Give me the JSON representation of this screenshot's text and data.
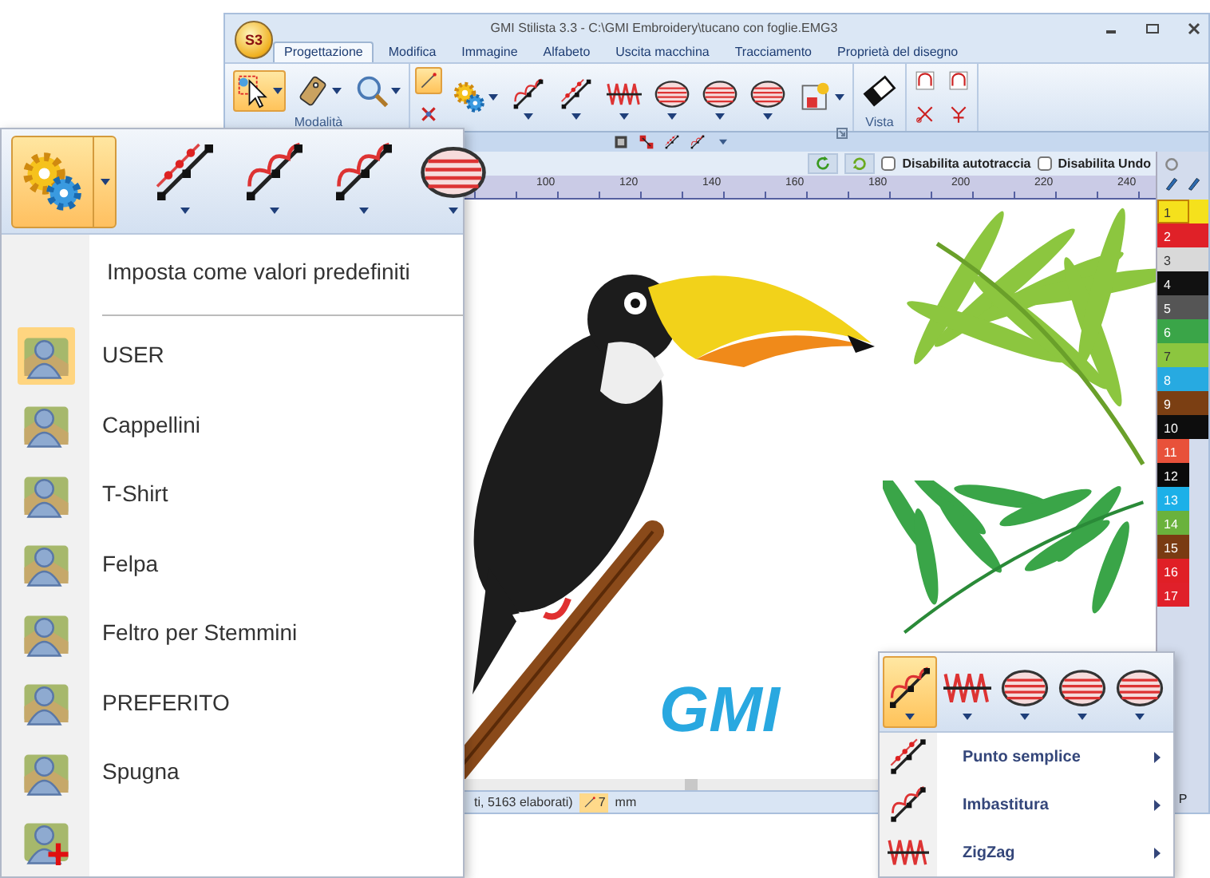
{
  "window": {
    "title": "GMI Stilista 3.3 - C:\\GMI Embroidery\\tucano con foglie.EMG3",
    "logo": "S3"
  },
  "tabs": [
    {
      "label": "Progettazione",
      "selected": true
    },
    {
      "label": "Modifica",
      "selected": false
    },
    {
      "label": "Immagine",
      "selected": false
    },
    {
      "label": "Alfabeto",
      "selected": false
    },
    {
      "label": "Uscita macchina",
      "selected": false
    },
    {
      "label": "Tracciamento",
      "selected": false
    },
    {
      "label": "Proprietà del disegno",
      "selected": false
    }
  ],
  "ribbon": {
    "groups": [
      {
        "label": "Modalità",
        "tools": [
          {
            "kind": "select",
            "selected": true,
            "dropdown": true
          },
          {
            "kind": "tag",
            "selected": false,
            "dropdown": true
          },
          {
            "kind": "zoom",
            "selected": false,
            "dropdown": true
          }
        ]
      },
      {
        "launcher": true,
        "tools": [
          {
            "kind": "stack",
            "items": [
              {
                "kind": "needle",
                "selected": true
              },
              {
                "kind": "cross",
                "selected": false
              }
            ]
          },
          {
            "kind": "gears",
            "selected": false,
            "dropdown": true
          },
          {
            "kind": "baste",
            "selected": false,
            "dropdown": true,
            "caret_below": true
          },
          {
            "kind": "running",
            "selected": false,
            "dropdown": true,
            "caret_below": true
          },
          {
            "kind": "zigzag",
            "selected": false,
            "dropdown": true,
            "caret_below": true
          },
          {
            "kind": "fill",
            "selected": false,
            "dropdown": true,
            "caret_below": true
          },
          {
            "kind": "fill",
            "selected": false,
            "dropdown": true,
            "caret_below": true
          },
          {
            "kind": "fill",
            "selected": false,
            "dropdown": true,
            "caret_below": true
          },
          {
            "kind": "picture",
            "selected": false,
            "dropdown": true
          }
        ]
      },
      {
        "label": "Vista",
        "tools": [
          {
            "kind": "eraser",
            "selected": false
          }
        ]
      },
      {
        "tools": [
          {
            "kind": "stack",
            "items": [
              {
                "kind": "arch",
                "selected": false
              },
              {
                "kind": "cut",
                "selected": false
              }
            ]
          },
          {
            "kind": "stack",
            "items": [
              {
                "kind": "arch",
                "selected": false
              },
              {
                "kind": "spread",
                "selected": false
              }
            ]
          }
        ]
      }
    ]
  },
  "quick_access": [
    {
      "kind": "box"
    },
    {
      "kind": "resize"
    },
    {
      "kind": "running"
    },
    {
      "kind": "baste"
    },
    {
      "kind": "more"
    }
  ],
  "canvas_toolbar": {
    "buttons": [
      {
        "kind": "refresh"
      },
      {
        "kind": "redo"
      }
    ],
    "checkboxes": [
      {
        "label": "Disabilita autotraccia",
        "checked": false
      },
      {
        "label": "Disabilita Undo",
        "checked": false
      }
    ]
  },
  "ruler": {
    "labels": [
      "100",
      "120",
      "140",
      "160",
      "180",
      "200",
      "220",
      "240"
    ]
  },
  "canvas": {
    "logo_text": "GMI"
  },
  "status": {
    "info": "ti, 5163 elaborati)",
    "stitch_length": "7",
    "unit": "mm"
  },
  "palette": {
    "header": [
      {
        "kind": "circle"
      },
      {
        "kind": "pen"
      },
      {
        "kind": "pen"
      }
    ],
    "colors": [
      {
        "label": "1",
        "color": "#f5e11c",
        "selected": true
      },
      {
        "label": "2",
        "color": "#e02128",
        "selected": false
      },
      {
        "label": "3",
        "color": "#d9d9d9",
        "selected": false
      },
      {
        "label": "4",
        "color": "#111111",
        "selected": false
      },
      {
        "label": "5",
        "color": "#555555",
        "selected": false
      },
      {
        "label": "6",
        "color": "#3aa548",
        "selected": false
      },
      {
        "label": "7",
        "color": "#8cc63f",
        "selected": false
      },
      {
        "label": "8",
        "color": "#27aae1",
        "selected": false
      },
      {
        "label": "9",
        "color": "#7b3f13",
        "selected": false
      },
      {
        "label": "10",
        "color": "#0d0d0d",
        "selected": false
      },
      {
        "label": "11",
        "color": "#e8513a",
        "selected": false
      },
      {
        "label": "12",
        "color": "#0a0a0a",
        "selected": false
      },
      {
        "label": "13",
        "color": "#1cb0e8",
        "selected": false
      },
      {
        "label": "14",
        "color": "#6ab23c",
        "selected": false
      },
      {
        "label": "15",
        "color": "#7a3b12",
        "selected": false
      },
      {
        "label": "16",
        "color": "#e01f26",
        "selected": false
      },
      {
        "label": "17",
        "color": "#e0202a",
        "selected": false
      }
    ],
    "colors_2": [
      {
        "color": "#f5e11c"
      },
      {
        "color": "#e02128"
      },
      {
        "color": "#d9d9d9"
      },
      {
        "color": "#111111"
      },
      {
        "color": "#555555"
      },
      {
        "color": "#3aa548"
      },
      {
        "color": "#8cc63f"
      },
      {
        "color": "#27aae1"
      },
      {
        "color": "#7b3f13"
      },
      {
        "color": "#0d0d0d"
      }
    ],
    "footer": "P"
  },
  "profiles_panel": {
    "toolbar": [
      {
        "kind": "gears",
        "selected": true,
        "dropdown": true,
        "split": true
      },
      {
        "kind": "running",
        "selected": false,
        "dropdown": true,
        "caret_below": true
      },
      {
        "kind": "baste",
        "selected": false,
        "dropdown": true,
        "caret_below": true
      },
      {
        "kind": "baste",
        "selected": false,
        "dropdown": true,
        "caret_below": true
      },
      {
        "kind": "fill",
        "selected": false,
        "dropdown": true,
        "caret_below": true
      }
    ],
    "header": "Imposta come valori predefiniti",
    "items": [
      {
        "kind": "profile",
        "label": "USER",
        "selected": true
      },
      {
        "kind": "profile",
        "label": "Cappellini",
        "selected": false
      },
      {
        "kind": "profile",
        "label": "T-Shirt",
        "selected": false
      },
      {
        "kind": "profile",
        "label": "Felpa",
        "selected": false
      },
      {
        "kind": "profile",
        "label": "Feltro per Stemmini",
        "selected": false
      },
      {
        "kind": "profile",
        "label": "PREFERITO",
        "selected": false
      },
      {
        "kind": "profile",
        "label": "Spugna",
        "selected": false
      },
      {
        "kind": "add",
        "selected": false
      }
    ]
  },
  "stitch_panel": {
    "toolbar": [
      {
        "kind": "baste",
        "selected": true,
        "dropdown": true,
        "caret_below": true
      },
      {
        "kind": "zigzag",
        "selected": false,
        "dropdown": true,
        "caret_below": true
      },
      {
        "kind": "fill",
        "selected": false,
        "dropdown": true,
        "caret_below": true
      },
      {
        "kind": "fill",
        "selected": false,
        "dropdown": true,
        "caret_below": true
      },
      {
        "kind": "fill",
        "selected": false,
        "dropdown": true,
        "caret_below": true
      }
    ],
    "items": [
      {
        "kind": "running",
        "label": "Punto semplice",
        "submenu": true
      },
      {
        "kind": "baste",
        "label": "Imbastitura",
        "submenu": true
      },
      {
        "kind": "zigzag",
        "label": "ZigZag",
        "submenu": true
      }
    ]
  }
}
